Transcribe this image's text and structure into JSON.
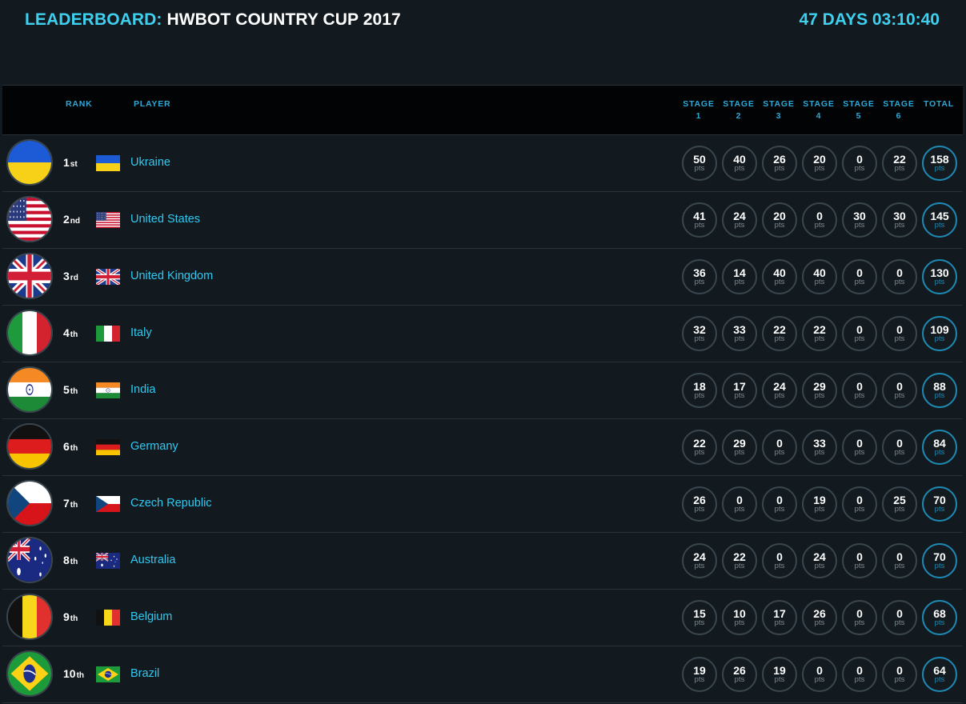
{
  "header": {
    "title_label": "LEADERBOARD:",
    "title_name": "HWBOT COUNTRY CUP 2017",
    "countdown": "47 DAYS 03:10:40"
  },
  "columns": {
    "rank": "RANK",
    "player": "PLAYER",
    "stages": [
      {
        "word": "STAGE",
        "num": "1"
      },
      {
        "word": "STAGE",
        "num": "2"
      },
      {
        "word": "STAGE",
        "num": "3"
      },
      {
        "word": "STAGE",
        "num": "4"
      },
      {
        "word": "STAGE",
        "num": "5"
      },
      {
        "word": "STAGE",
        "num": "6"
      }
    ],
    "total": "TOTAL"
  },
  "unit": "pts",
  "colors": {
    "accent": "#3fd0f0",
    "link": "#32c8f0",
    "header_label": "#2fa8d6",
    "total_ring": "#1e8ab4",
    "background": "#131a1f"
  },
  "rows": [
    {
      "rank": "1",
      "suffix": "st",
      "country": "Ukraine",
      "flag": "ua-flag",
      "stages": [
        "50",
        "40",
        "26",
        "20",
        "0",
        "22"
      ],
      "total": "158"
    },
    {
      "rank": "2",
      "suffix": "nd",
      "country": "United States",
      "flag": "us-flag",
      "stages": [
        "41",
        "24",
        "20",
        "0",
        "30",
        "30"
      ],
      "total": "145"
    },
    {
      "rank": "3",
      "suffix": "rd",
      "country": "United Kingdom",
      "flag": "gb-flag",
      "stages": [
        "36",
        "14",
        "40",
        "40",
        "0",
        "0"
      ],
      "total": "130"
    },
    {
      "rank": "4",
      "suffix": "th",
      "country": "Italy",
      "flag": "it-flag",
      "stages": [
        "32",
        "33",
        "22",
        "22",
        "0",
        "0"
      ],
      "total": "109"
    },
    {
      "rank": "5",
      "suffix": "th",
      "country": "India",
      "flag": "in-flag",
      "stages": [
        "18",
        "17",
        "24",
        "29",
        "0",
        "0"
      ],
      "total": "88"
    },
    {
      "rank": "6",
      "suffix": "th",
      "country": "Germany",
      "flag": "de-flag",
      "stages": [
        "22",
        "29",
        "0",
        "33",
        "0",
        "0"
      ],
      "total": "84"
    },
    {
      "rank": "7",
      "suffix": "th",
      "country": "Czech Republic",
      "flag": "cz-flag",
      "stages": [
        "26",
        "0",
        "0",
        "19",
        "0",
        "25"
      ],
      "total": "70"
    },
    {
      "rank": "8",
      "suffix": "th",
      "country": "Australia",
      "flag": "au-flag",
      "stages": [
        "24",
        "22",
        "0",
        "24",
        "0",
        "0"
      ],
      "total": "70"
    },
    {
      "rank": "9",
      "suffix": "th",
      "country": "Belgium",
      "flag": "be-flag",
      "stages": [
        "15",
        "10",
        "17",
        "26",
        "0",
        "0"
      ],
      "total": "68"
    },
    {
      "rank": "10",
      "suffix": "th",
      "country": "Brazil",
      "flag": "br-flag",
      "stages": [
        "19",
        "26",
        "19",
        "0",
        "0",
        "0"
      ],
      "total": "64"
    }
  ]
}
